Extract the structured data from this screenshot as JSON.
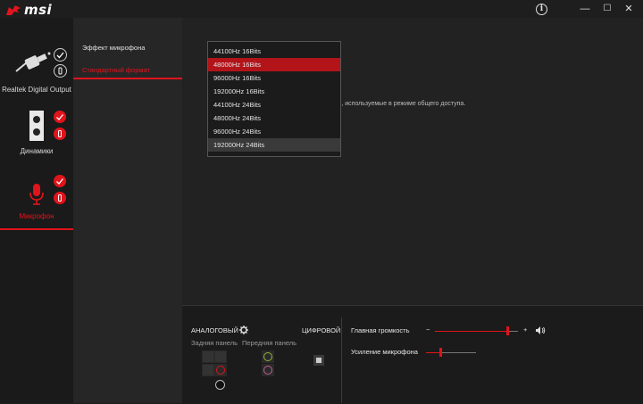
{
  "app": {
    "brand": "msi"
  },
  "titlebar": {
    "info_glyph": "i",
    "minimize_glyph": "—",
    "maximize_glyph": "☐",
    "close_glyph": "✕"
  },
  "devices": [
    {
      "label": "Realtek Digital Output",
      "icon": "spdif-cable-icon",
      "selected": false
    },
    {
      "label": "Динамики",
      "icon": "speaker-icon",
      "selected": false
    },
    {
      "label": "Микрофон",
      "icon": "microphone-icon",
      "selected": true
    }
  ],
  "options": {
    "mic_effect": "Эффект микрофона",
    "default_format": "Стандартный формат"
  },
  "main": {
    "description_fragment": "сть, используемые в режиме общего доступа."
  },
  "format_dropdown": {
    "selected": "48000Hz 16Bits",
    "options": [
      "44100Hz 16Bits",
      "48000Hz 16Bits",
      "96000Hz 16Bits",
      "192000Hz 16Bits",
      "44100Hz 24Bits",
      "48000Hz 24Bits",
      "96000Hz 24Bits",
      "192000Hz 24Bits"
    ]
  },
  "bottom": {
    "analog_label": "АНАЛОГОВЫЙ",
    "digital_label": "ЦИФРОВОЙ",
    "rear_panel_label": "Задняя панель",
    "front_panel_label": "Передняя панель",
    "master_volume_label": "Главная громкость",
    "minus": "−",
    "plus": "+",
    "mic_boost_label": "Усиление микрофона",
    "master_volume_level": 0.88,
    "mic_boost_level": 0.3
  },
  "colors": {
    "accent": "#e0141c",
    "jack_green": "#8fb43a",
    "jack_pink": "#c06090"
  }
}
